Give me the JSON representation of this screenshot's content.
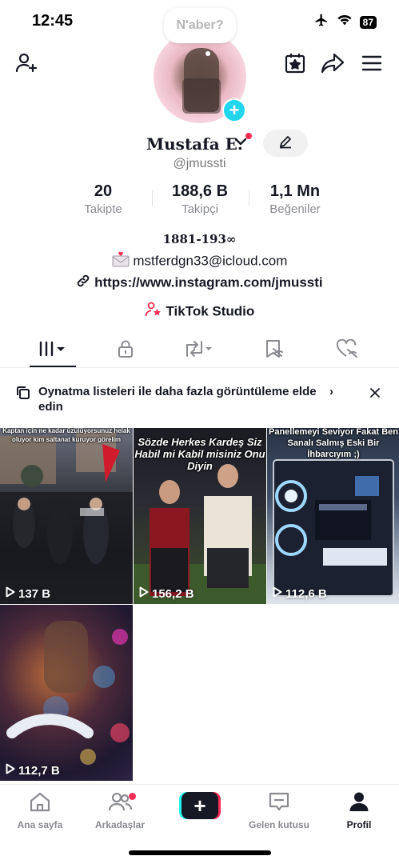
{
  "status_bar": {
    "time": "12:45",
    "battery": "87"
  },
  "profile": {
    "note": "N'aber?",
    "display_name": "Mustafa E.",
    "username": "@jmussti"
  },
  "stats": [
    {
      "value": "20",
      "label": "Takipte"
    },
    {
      "value": "188,6 B",
      "label": "Takipçi"
    },
    {
      "value": "1,1 Mn",
      "label": "Beğeniler"
    }
  ],
  "bio": {
    "line1": "1881-193∞",
    "email": "mstferdgn33@icloud.com",
    "link": "https://www.instagram.com/jmussti",
    "studio": "TikTok Studio"
  },
  "banner": {
    "text": "Oynatma listeleri ile daha fazla görüntüleme elde edin",
    "chevron": "›"
  },
  "videos": [
    {
      "views": "137 B",
      "caption": "Kaptan için ne kadar üzülüyorsunuz helak oluyor kim saltanat kuruyor görelim"
    },
    {
      "views": "156,2 B",
      "caption": "Sözde Herkes Kardeş Siz Habil mi Kabil misiniz Onu Diyin"
    },
    {
      "views": "112,6 B",
      "caption": "Panellemeyi Seviyor Fakat Ben Sanalı Salmış Eski Bir İhbarcıyım ;)"
    },
    {
      "views": "112,7 B",
      "caption": ""
    }
  ],
  "bottom_nav": [
    {
      "label": "Ana sayfa",
      "icon": "home-icon"
    },
    {
      "label": "Arkadaşlar",
      "icon": "friends-icon"
    },
    {
      "label": "",
      "icon": "create-icon"
    },
    {
      "label": "Gelen kutusu",
      "icon": "inbox-icon"
    },
    {
      "label": "Profil",
      "icon": "profile-icon"
    }
  ],
  "colors": {
    "accent": "#fe2c55",
    "cyan": "#25f4ee",
    "plus_badge": "#20d5ec"
  }
}
